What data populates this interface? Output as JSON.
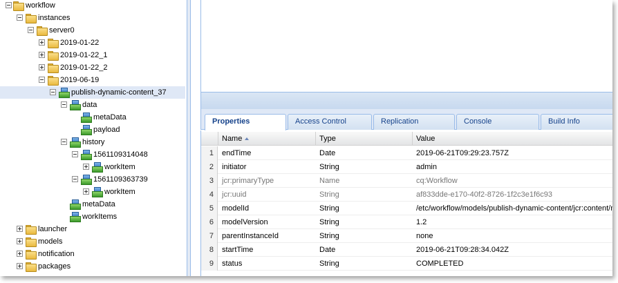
{
  "tree": {
    "nodes": [
      {
        "label": "workflow",
        "icon": "folder-icon",
        "toggle": "minus"
      },
      {
        "label": "instances",
        "icon": "folder-icon",
        "toggle": "minus"
      },
      {
        "label": "server0",
        "icon": "folder-icon",
        "toggle": "minus"
      },
      {
        "label": "2019-01-22",
        "icon": "folder-icon",
        "toggle": "plus"
      },
      {
        "label": "2019-01-22_1",
        "icon": "folder-icon",
        "toggle": "plus"
      },
      {
        "label": "2019-01-22_2",
        "icon": "folder-icon",
        "toggle": "plus"
      },
      {
        "label": "2019-06-19",
        "icon": "folder-icon",
        "toggle": "minus"
      },
      {
        "label": "publish-dynamic-content_37",
        "icon": "node-icon",
        "toggle": "minus",
        "selected": true
      },
      {
        "label": "data",
        "icon": "node-icon",
        "toggle": "minus"
      },
      {
        "label": "metaData",
        "icon": "node-icon",
        "toggle": null
      },
      {
        "label": "payload",
        "icon": "node-icon",
        "toggle": null
      },
      {
        "label": "history",
        "icon": "node-icon",
        "toggle": "minus"
      },
      {
        "label": "1561109314048",
        "icon": "node-icon",
        "toggle": "minus"
      },
      {
        "label": "workItem",
        "icon": "node-icon",
        "toggle": "plus"
      },
      {
        "label": "1561109363739",
        "icon": "node-icon",
        "toggle": "minus"
      },
      {
        "label": "workItem",
        "icon": "node-icon",
        "toggle": "plus"
      },
      {
        "label": "metaData",
        "icon": "node-icon",
        "toggle": null
      },
      {
        "label": "workItems",
        "icon": "node-icon",
        "toggle": null
      },
      {
        "label": "launcher",
        "icon": "folder-icon",
        "toggle": "plus"
      },
      {
        "label": "models",
        "icon": "folder-icon",
        "toggle": "plus"
      },
      {
        "label": "notification",
        "icon": "folder-icon",
        "toggle": "plus"
      },
      {
        "label": "packages",
        "icon": "folder-icon",
        "toggle": "plus"
      }
    ]
  },
  "tabs": [
    {
      "label": "Properties",
      "active": true
    },
    {
      "label": "Access Control"
    },
    {
      "label": "Replication"
    },
    {
      "label": "Console"
    },
    {
      "label": "Build Info"
    }
  ],
  "grid": {
    "columns": [
      "Name",
      "Type",
      "Value"
    ],
    "sort_column": "Name",
    "rows": [
      {
        "num": "1",
        "name": "endTime",
        "type": "Date",
        "value": "2019-06-21T09:29:23.757Z"
      },
      {
        "num": "2",
        "name": "initiator",
        "type": "String",
        "value": "admin"
      },
      {
        "num": "3",
        "name": "jcr:primaryType",
        "type": "Name",
        "value": "cq:Workflow",
        "muted": true
      },
      {
        "num": "4",
        "name": "jcr:uuid",
        "type": "String",
        "value": "af833dde-e170-40f2-8726-1f2c3e1f6c93",
        "muted": true
      },
      {
        "num": "5",
        "name": "modelId",
        "type": "String",
        "value": "/etc/workflow/models/publish-dynamic-content/jcr:content/model"
      },
      {
        "num": "6",
        "name": "modelVersion",
        "type": "String",
        "value": "1.2"
      },
      {
        "num": "7",
        "name": "parentInstanceId",
        "type": "String",
        "value": "none"
      },
      {
        "num": "8",
        "name": "startTime",
        "type": "Date",
        "value": "2019-06-21T09:28:34.042Z"
      },
      {
        "num": "9",
        "name": "status",
        "type": "String",
        "value": "COMPLETED"
      }
    ]
  }
}
